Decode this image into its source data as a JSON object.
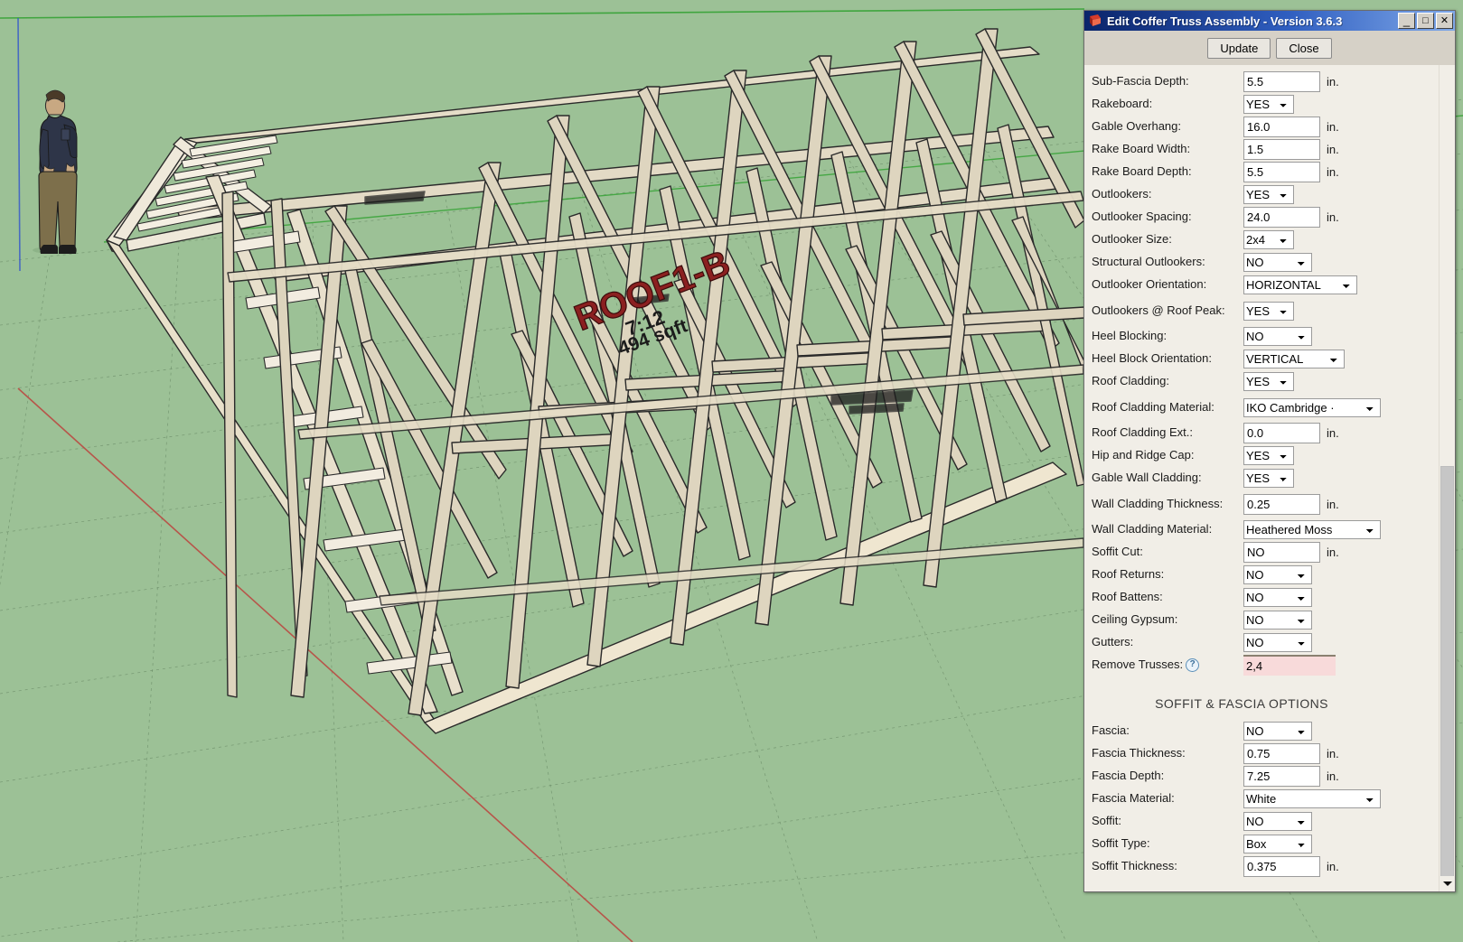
{
  "window": {
    "title": "Edit Coffer Truss Assembly - Version 3.6.3",
    "icon": "sketchup-icon",
    "minimize_label": "_",
    "maximize_label": "□",
    "close_label": "✕"
  },
  "toolbar": {
    "update_label": "Update",
    "close_label": "Close"
  },
  "units": {
    "inches": "in."
  },
  "form": {
    "fields": [
      {
        "label": "Sub-Fascia Depth:",
        "type": "text",
        "value": "5.5",
        "unit": "in."
      },
      {
        "label": "Rakeboard:",
        "type": "select",
        "value": "YES",
        "size": "s-sm"
      },
      {
        "label": "Gable Overhang:",
        "type": "text",
        "value": "16.0",
        "unit": "in."
      },
      {
        "label": "Rake Board Width:",
        "type": "text",
        "value": "1.5",
        "unit": "in."
      },
      {
        "label": "Rake Board Depth:",
        "type": "text",
        "value": "5.5",
        "unit": "in."
      },
      {
        "label": "Outlookers:",
        "type": "select",
        "value": "YES",
        "size": "s-sm"
      },
      {
        "label": "Outlooker Spacing:",
        "type": "text",
        "value": "24.0",
        "unit": "in."
      },
      {
        "label": "Outlooker Size:",
        "type": "select",
        "value": "2x4",
        "size": "s-sm"
      },
      {
        "label": "Structural Outlookers:",
        "type": "select",
        "value": "NO",
        "size": "s-md"
      },
      {
        "label": "Outlooker Orientation:",
        "type": "select",
        "value": "HORIZONTAL",
        "size": "s-xl"
      },
      {
        "label": "Outlookers @ Roof Peak:",
        "type": "select",
        "value": "YES",
        "size": "s-sm",
        "tall": true
      },
      {
        "label": "Heel Blocking:",
        "type": "select",
        "value": "NO",
        "size": "s-md"
      },
      {
        "label": "Heel Block Orientation:",
        "type": "select",
        "value": "VERTICAL",
        "size": "s-lg"
      },
      {
        "label": "Roof Cladding:",
        "type": "select",
        "value": "YES",
        "size": "s-sm"
      },
      {
        "label": "Roof Cladding Material:",
        "type": "select",
        "value": "IKO Cambridge ·",
        "size": "s-xxl",
        "tall": true
      },
      {
        "label": "Roof Cladding Ext.:",
        "type": "text",
        "value": "0.0",
        "unit": "in."
      },
      {
        "label": "Hip and Ridge Cap:",
        "type": "select",
        "value": "YES",
        "size": "s-sm"
      },
      {
        "label": "Gable Wall Cladding:",
        "type": "select",
        "value": "YES",
        "size": "s-sm"
      },
      {
        "label": "Wall Cladding Thickness:",
        "type": "text",
        "value": "0.25",
        "unit": "in.",
        "tall": true
      },
      {
        "label": "Wall Cladding Material:",
        "type": "select",
        "value": "Heathered Moss",
        "size": "s-xxl"
      },
      {
        "label": "Soffit Cut:",
        "type": "text",
        "value": "NO",
        "unit": "in."
      },
      {
        "label": "Roof Returns:",
        "type": "select",
        "value": "NO",
        "size": "s-md"
      },
      {
        "label": "Roof Battens:",
        "type": "select",
        "value": "NO",
        "size": "s-md"
      },
      {
        "label": "Ceiling Gypsum:",
        "type": "select",
        "value": "NO",
        "size": "s-md"
      },
      {
        "label": "Gutters:",
        "type": "select",
        "value": "NO",
        "size": "s-md"
      },
      {
        "label": "Remove Trusses:",
        "type": "text",
        "value": "2,4",
        "help": "?",
        "highlight": true
      }
    ],
    "section_title": "SOFFIT & FASCIA OPTIONS",
    "section_fields": [
      {
        "label": "Fascia:",
        "type": "select",
        "value": "NO",
        "size": "s-md"
      },
      {
        "label": "Fascia Thickness:",
        "type": "text",
        "value": "0.75",
        "unit": "in."
      },
      {
        "label": "Fascia Depth:",
        "type": "text",
        "value": "7.25",
        "unit": "in."
      },
      {
        "label": "Fascia Material:",
        "type": "select",
        "value": "White",
        "size": "s-xxl"
      },
      {
        "label": "Soffit:",
        "type": "select",
        "value": "NO",
        "size": "s-md"
      },
      {
        "label": "Soffit Type:",
        "type": "select",
        "value": "Box",
        "size": "s-md"
      },
      {
        "label": "Soffit Thickness:",
        "type": "text",
        "value": "0.375",
        "unit": "in."
      }
    ]
  },
  "model": {
    "labels": [
      {
        "text": "ROOF1-B",
        "color": "#8b2020"
      },
      {
        "text": "7:12",
        "color": "#1b1b1b"
      },
      {
        "text": "494 sqft",
        "color": "#1b1b1b"
      }
    ],
    "background_color": "#9cc196",
    "timber_color": "#ded6c3",
    "scale_figure": "person-figure"
  }
}
